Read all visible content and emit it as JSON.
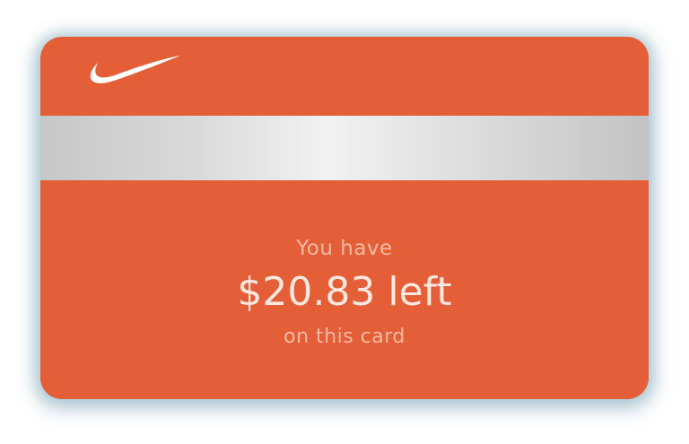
{
  "card": {
    "brand_logo": "swoosh-icon",
    "intro_text": "You have",
    "balance_text": "$20.83 left",
    "footer_text": "on this card"
  },
  "colors": {
    "card_background": "#e45e37",
    "stripe": "#d9d9d9",
    "text_primary": "#fbe8e0",
    "text_secondary": "#f6b9a3"
  }
}
